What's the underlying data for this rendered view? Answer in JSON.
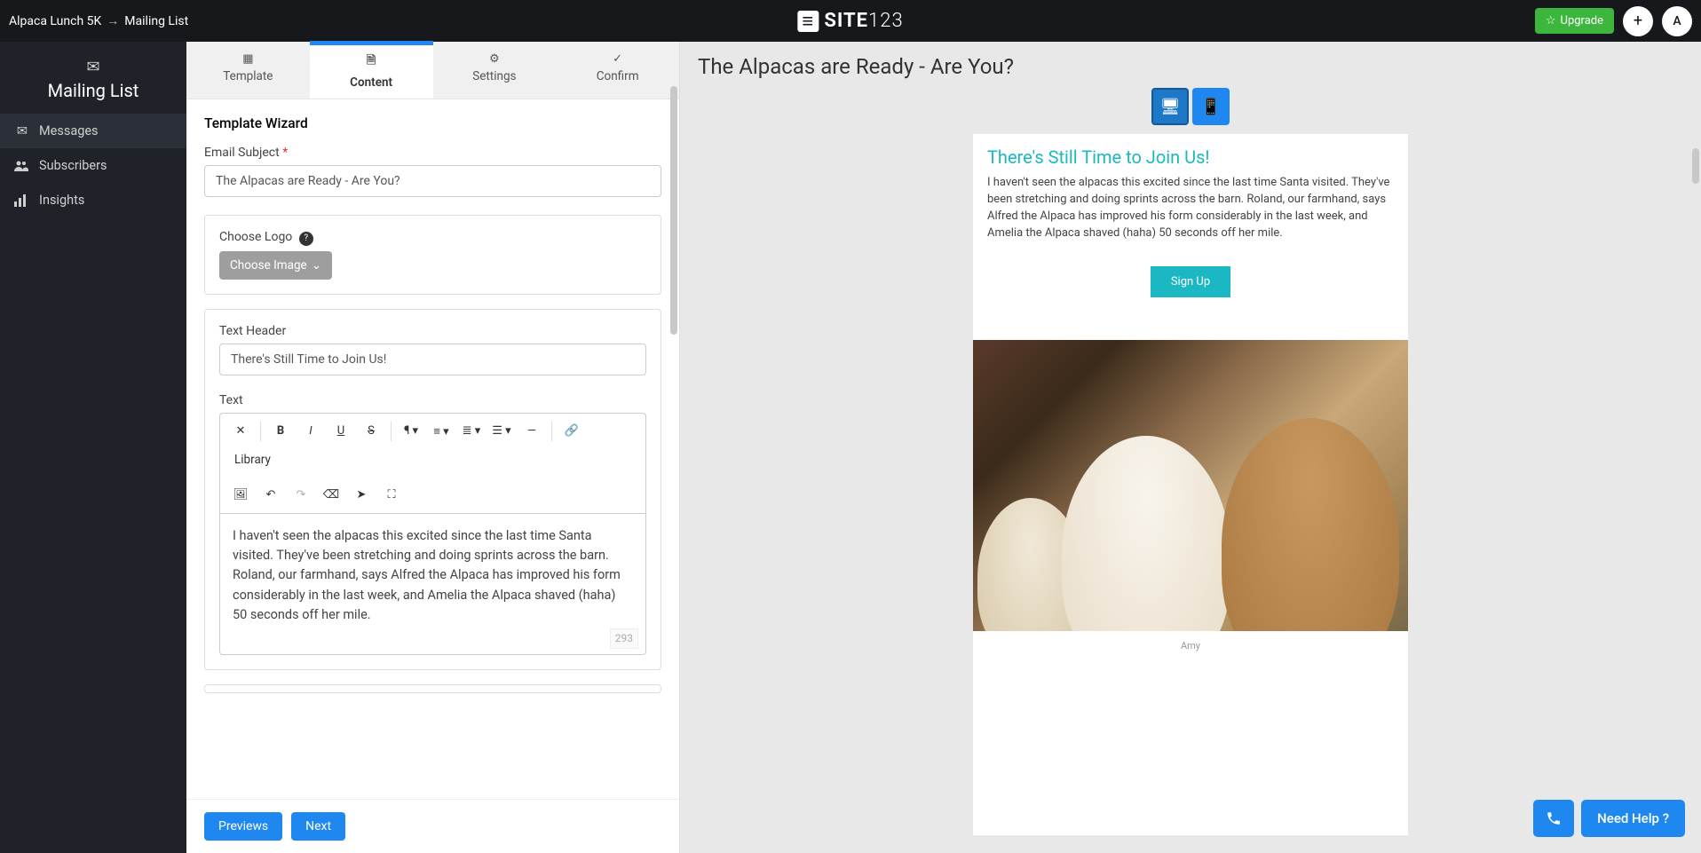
{
  "header": {
    "breadcrumb_site": "Alpaca Lunch 5K",
    "breadcrumb_page": "Mailing List",
    "logo_site": "SITE",
    "logo_123": "123",
    "upgrade": "Upgrade",
    "avatar_letter": "A"
  },
  "sidebar": {
    "title": "Mailing List",
    "items": [
      {
        "label": "Messages"
      },
      {
        "label": "Subscribers"
      },
      {
        "label": "Insights"
      }
    ]
  },
  "wizard": {
    "tabs": [
      {
        "label": "Template"
      },
      {
        "label": "Content"
      },
      {
        "label": "Settings"
      },
      {
        "label": "Confirm"
      }
    ],
    "title": "Template Wizard",
    "subject_label": "Email Subject",
    "subject_value": "The Alpacas are Ready - Are You?",
    "choose_logo_label": "Choose Logo",
    "choose_image_btn": "Choose Image",
    "text_header_label": "Text Header",
    "text_header_value": "There's Still Time to Join Us!",
    "text_label": "Text",
    "body_text": "I haven't seen the alpacas this excited since the last time Santa visited. They've been stretching and doing sprints across the barn. Roland, our farmhand, says Alfred the Alpaca has improved his form considerably in the last week, and Amelia the Alpaca shaved (haha) 50 seconds off her mile.",
    "char_count": "293",
    "library_btn": "Library",
    "previews_btn": "Previews",
    "next_btn": "Next"
  },
  "preview": {
    "title": "The Alpacas are Ready - Are You?",
    "header": "There's Still Time to Join Us!",
    "body": "I haven't seen the alpacas this excited since the last time Santa visited. They've been stretching and doing sprints across the barn. Roland, our farmhand, says Alfred the Alpaca has improved his form considerably in the last week, and Amelia the Alpaca shaved (haha) 50 seconds off her mile.",
    "cta": "Sign Up",
    "footer_name": "Amy"
  },
  "help": {
    "text": "Need Help ?"
  }
}
